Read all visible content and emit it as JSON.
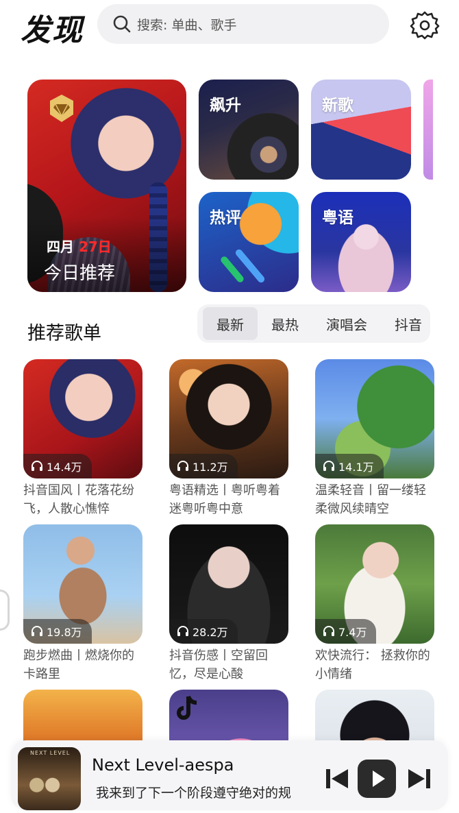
{
  "header": {
    "title": "发现",
    "search_placeholder": "搜索: 单曲、歌手",
    "icons": {
      "search": "search-icon",
      "settings": "gear-icon"
    }
  },
  "features": {
    "daily": {
      "month": "四月",
      "day": "27日",
      "title": "今日推荐",
      "badge_icon": "diamond-badge-icon"
    },
    "cards": [
      {
        "label": "飙升"
      },
      {
        "label": "新歌"
      },
      {
        "label": "热评"
      },
      {
        "label": "粤语"
      }
    ]
  },
  "playlists_section": {
    "title": "推荐歌单",
    "tabs": [
      "最新",
      "最热",
      "演唱会",
      "抖音"
    ],
    "active_tab": "最新"
  },
  "playlists": [
    {
      "plays": "14.4万",
      "title": "抖音国风丨花落花纷飞，人散心憔悴"
    },
    {
      "plays": "11.2万",
      "title": "粤语精选丨粤听粤着迷粤听粤中意"
    },
    {
      "plays": "14.1万",
      "title": "温柔轻音丨留一缕轻柔微风续晴空"
    },
    {
      "plays": "19.8万",
      "title": "跑步燃曲丨燃烧你的卡路里"
    },
    {
      "plays": "28.2万",
      "title": "抖音伤感丨空留回忆，尽是心酸"
    },
    {
      "plays": "7.4万",
      "title": "欢快流行： 拯救你的小情绪"
    },
    {
      "plays": "",
      "title": ""
    },
    {
      "plays": "",
      "title": ""
    },
    {
      "plays": "",
      "title": ""
    }
  ],
  "player": {
    "song": "Next Level-aespa",
    "lyric": "我来到了下一个阶段遵守绝对的规",
    "art_text": "NEXT LEVEL",
    "controls": [
      "prev-icon",
      "play-icon",
      "next-icon"
    ]
  },
  "colors": {
    "accent_red": "#ff2a2a",
    "background": "#ffffff",
    "search_bg": "#f1f1f3"
  }
}
